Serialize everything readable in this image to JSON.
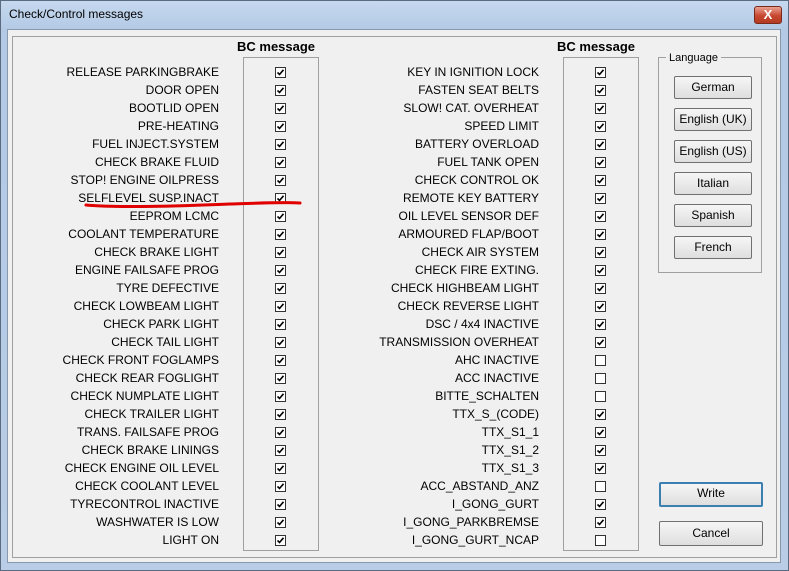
{
  "window": {
    "title": "Check/Control messages",
    "close_glyph": "X"
  },
  "left_column": {
    "header": "BC message",
    "items": [
      {
        "label": "RELEASE PARKINGBRAKE",
        "checked": true
      },
      {
        "label": "DOOR OPEN",
        "checked": true
      },
      {
        "label": "BOOTLID OPEN",
        "checked": true
      },
      {
        "label": "PRE-HEATING",
        "checked": true
      },
      {
        "label": "FUEL INJECT.SYSTEM",
        "checked": true
      },
      {
        "label": "CHECK BRAKE FLUID",
        "checked": true
      },
      {
        "label": "STOP! ENGINE OILPRESS",
        "checked": true
      },
      {
        "label": "SELFLEVEL SUSP.INACT",
        "checked": true
      },
      {
        "label": "EEPROM LCMC",
        "checked": true
      },
      {
        "label": "COOLANT TEMPERATURE",
        "checked": true
      },
      {
        "label": "CHECK BRAKE LIGHT",
        "checked": true
      },
      {
        "label": "ENGINE FAILSAFE PROG",
        "checked": true
      },
      {
        "label": "TYRE DEFECTIVE",
        "checked": true
      },
      {
        "label": "CHECK LOWBEAM LIGHT",
        "checked": true
      },
      {
        "label": "CHECK PARK LIGHT",
        "checked": true
      },
      {
        "label": "CHECK TAIL LIGHT",
        "checked": true
      },
      {
        "label": "CHECK FRONT FOGLAMPS",
        "checked": true
      },
      {
        "label": "CHECK REAR FOGLIGHT",
        "checked": true
      },
      {
        "label": "CHECK NUMPLATE LIGHT",
        "checked": true
      },
      {
        "label": "CHECK TRAILER LIGHT",
        "checked": true
      },
      {
        "label": "TRANS. FAILSAFE PROG",
        "checked": true
      },
      {
        "label": "CHECK BRAKE LININGS",
        "checked": true
      },
      {
        "label": "CHECK ENGINE OIL LEVEL",
        "checked": true
      },
      {
        "label": "CHECK COOLANT LEVEL",
        "checked": true
      },
      {
        "label": "TYRECONTROL INACTIVE",
        "checked": true
      },
      {
        "label": "WASHWATER IS LOW",
        "checked": true
      },
      {
        "label": "LIGHT ON",
        "checked": true
      }
    ]
  },
  "right_column": {
    "header": "BC message",
    "items": [
      {
        "label": "KEY IN IGNITION LOCK",
        "checked": true
      },
      {
        "label": "FASTEN SEAT BELTS",
        "checked": true
      },
      {
        "label": "SLOW! CAT. OVERHEAT",
        "checked": true
      },
      {
        "label": "SPEED LIMIT",
        "checked": true
      },
      {
        "label": "BATTERY OVERLOAD",
        "checked": true
      },
      {
        "label": "FUEL TANK OPEN",
        "checked": true
      },
      {
        "label": "CHECK CONTROL OK",
        "checked": true
      },
      {
        "label": "REMOTE KEY BATTERY",
        "checked": true
      },
      {
        "label": "OIL LEVEL SENSOR DEF",
        "checked": true
      },
      {
        "label": "ARMOURED FLAP/BOOT",
        "checked": true
      },
      {
        "label": "CHECK AIR SYSTEM",
        "checked": true
      },
      {
        "label": "CHECK FIRE EXTING.",
        "checked": true
      },
      {
        "label": "CHECK HIGHBEAM LIGHT",
        "checked": true
      },
      {
        "label": "CHECK REVERSE LIGHT",
        "checked": true
      },
      {
        "label": "DSC / 4x4 INACTIVE",
        "checked": true
      },
      {
        "label": "TRANSMISSION OVERHEAT",
        "checked": true
      },
      {
        "label": "AHC INACTIVE",
        "checked": false
      },
      {
        "label": "ACC INACTIVE",
        "checked": false
      },
      {
        "label": "BITTE_SCHALTEN",
        "checked": false
      },
      {
        "label": "TTX_S_(CODE)",
        "checked": true
      },
      {
        "label": "TTX_S1_1",
        "checked": true
      },
      {
        "label": "TTX_S1_2",
        "checked": true
      },
      {
        "label": "TTX_S1_3",
        "checked": true
      },
      {
        "label": "ACC_ABSTAND_ANZ",
        "checked": false
      },
      {
        "label": "I_GONG_GURT",
        "checked": true
      },
      {
        "label": "I_GONG_PARKBREMSE",
        "checked": true
      },
      {
        "label": "I_GONG_GURT_NCAP",
        "checked": false
      }
    ]
  },
  "language": {
    "title": "Language",
    "buttons": [
      "German",
      "English (UK)",
      "English (US)",
      "Italian",
      "Spanish",
      "French"
    ]
  },
  "actions": {
    "write_label": "Write",
    "cancel_label": "Cancel"
  },
  "annotation": {
    "underline_color": "#e00000",
    "underlined_item": "SELFLEVEL SUSP.INACT"
  }
}
